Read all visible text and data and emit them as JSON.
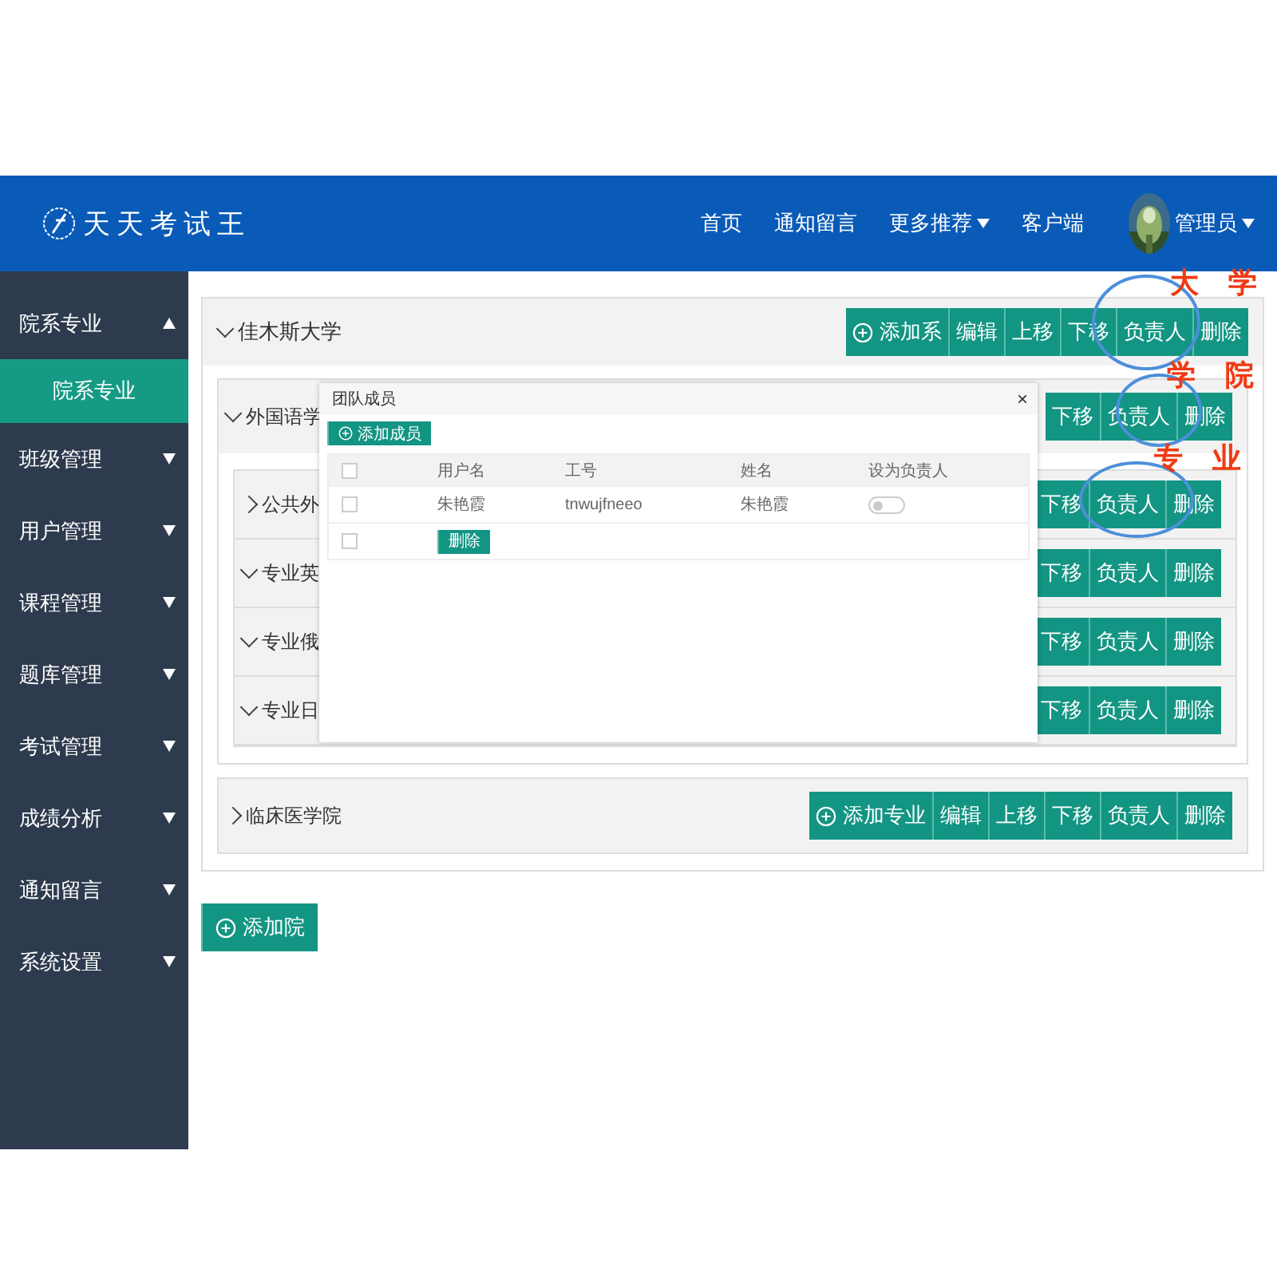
{
  "header": {
    "logo_text": "天天考试王",
    "nav": [
      {
        "label": "首页",
        "dropdown": false
      },
      {
        "label": "通知留言",
        "dropdown": false
      },
      {
        "label": "更多推荐",
        "dropdown": true
      },
      {
        "label": "客户端",
        "dropdown": false
      }
    ],
    "user": {
      "name": "管理员",
      "dropdown": true
    }
  },
  "sidebar": {
    "items": [
      {
        "label": "院系专业",
        "expanded": true,
        "children": [
          {
            "label": "院系专业",
            "selected": true
          }
        ]
      },
      {
        "label": "班级管理",
        "expanded": false
      },
      {
        "label": "用户管理",
        "expanded": false
      },
      {
        "label": "课程管理",
        "expanded": false
      },
      {
        "label": "题库管理",
        "expanded": false
      },
      {
        "label": "考试管理",
        "expanded": false
      },
      {
        "label": "成绩分析",
        "expanded": false
      },
      {
        "label": "通知留言",
        "expanded": false
      },
      {
        "label": "系统设置",
        "expanded": false
      }
    ]
  },
  "tree": {
    "label": "佳木斯大学",
    "expanded": true,
    "buttons": [
      {
        "label": "添加系",
        "kind": "add"
      },
      {
        "label": "编辑",
        "kind": "plain"
      },
      {
        "label": "上移",
        "kind": "plain"
      },
      {
        "label": "下移",
        "kind": "plain"
      },
      {
        "label": "负责人",
        "kind": "plain"
      },
      {
        "label": "删除",
        "kind": "plain"
      }
    ],
    "children": [
      {
        "label": "外国语学",
        "expanded": true,
        "buttons": [
          {
            "label": "下移",
            "kind": "plain"
          },
          {
            "label": "负责人",
            "kind": "plain"
          },
          {
            "label": "删除",
            "kind": "plain"
          }
        ],
        "children": [
          {
            "label": "公共外",
            "expanded": false,
            "buttons": [
              {
                "label": "下移",
                "kind": "plain"
              },
              {
                "label": "负责人",
                "kind": "plain"
              },
              {
                "label": "删除",
                "kind": "plain"
              }
            ]
          },
          {
            "label": "专业英",
            "expanded": true,
            "buttons": [
              {
                "label": "下移",
                "kind": "plain"
              },
              {
                "label": "负责人",
                "kind": "plain"
              },
              {
                "label": "删除",
                "kind": "plain"
              }
            ]
          },
          {
            "label": "专业俄",
            "expanded": true,
            "buttons": [
              {
                "label": "下移",
                "kind": "plain"
              },
              {
                "label": "负责人",
                "kind": "plain"
              },
              {
                "label": "删除",
                "kind": "plain"
              }
            ]
          },
          {
            "label": "专业日",
            "expanded": true,
            "buttons": [
              {
                "label": "下移",
                "kind": "plain"
              },
              {
                "label": "负责人",
                "kind": "plain"
              },
              {
                "label": "删除",
                "kind": "plain"
              }
            ]
          }
        ]
      },
      {
        "label": "临床医学院",
        "expanded": false,
        "buttons": [
          {
            "label": "添加专业",
            "kind": "add"
          },
          {
            "label": "编辑",
            "kind": "plain"
          },
          {
            "label": "上移",
            "kind": "plain"
          },
          {
            "label": "下移",
            "kind": "plain"
          },
          {
            "label": "负责人",
            "kind": "plain"
          },
          {
            "label": "删除",
            "kind": "plain"
          }
        ]
      }
    ]
  },
  "add_button": {
    "label": "添加院"
  },
  "modal": {
    "title": "团队成员",
    "close": "×",
    "add_button": "添加成员",
    "columns": [
      "用户名",
      "工号",
      "姓名",
      "设为负责人"
    ],
    "select_all_checked": false,
    "rows": [
      {
        "checked": false,
        "cells": [
          "朱艳霞",
          "tnwujfneeo",
          "朱艳霞"
        ],
        "leader_on": false
      }
    ],
    "footer": {
      "checked": false,
      "delete_button": "删除"
    }
  },
  "annotations": [
    {
      "text": "大 学"
    },
    {
      "text": "学 院"
    },
    {
      "text": "专 业"
    }
  ]
}
